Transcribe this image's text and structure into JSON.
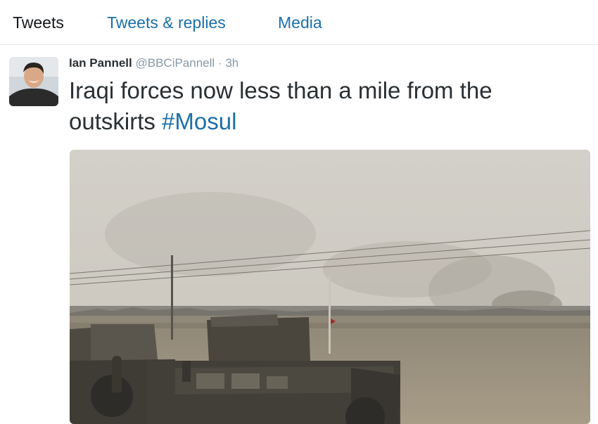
{
  "tabs": [
    {
      "label": "Tweets"
    },
    {
      "label": "Tweets & replies"
    },
    {
      "label": "Media"
    }
  ],
  "tweet": {
    "author_name": "Ian Pannell",
    "handle": "@BBCiPannell",
    "separator": "·",
    "time": "3h",
    "text": "Iraqi forces now less than a mile from the outskirts",
    "hashtag": "#Mosul"
  },
  "colors": {
    "link": "#1b6fa8",
    "text": "#292f33",
    "muted": "#8899a6"
  }
}
